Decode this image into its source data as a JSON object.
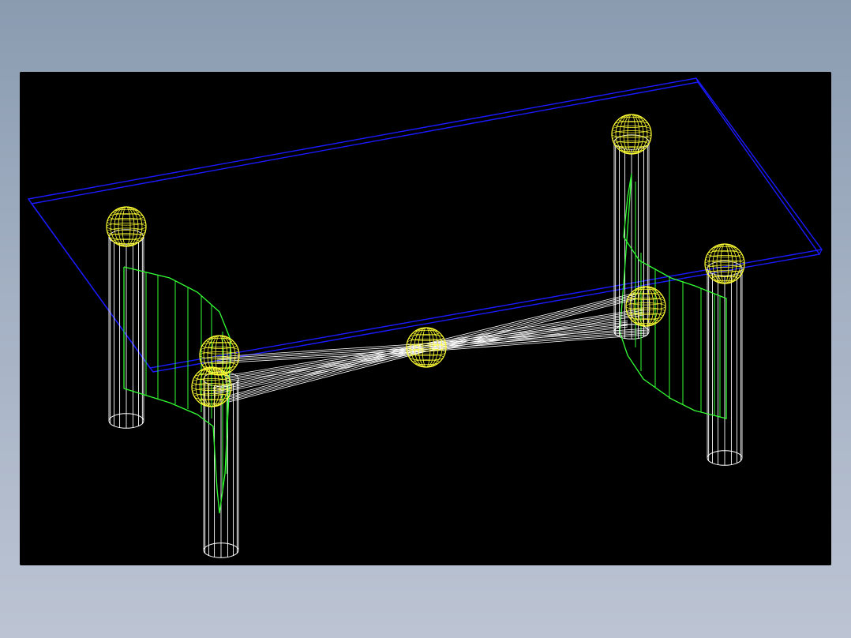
{
  "viewport": {
    "background": "#000000"
  },
  "colors": {
    "tabletop": "#1a1aff",
    "spheres": "#ffff33",
    "legs": "#ffffff",
    "stretchers": "#ffffff",
    "side_panels": "#33ff33",
    "page_background_top": "#8a9bb0",
    "page_background_bottom": "#bcc4d3"
  },
  "model": {
    "object": "table",
    "render_style": "wireframe"
  }
}
